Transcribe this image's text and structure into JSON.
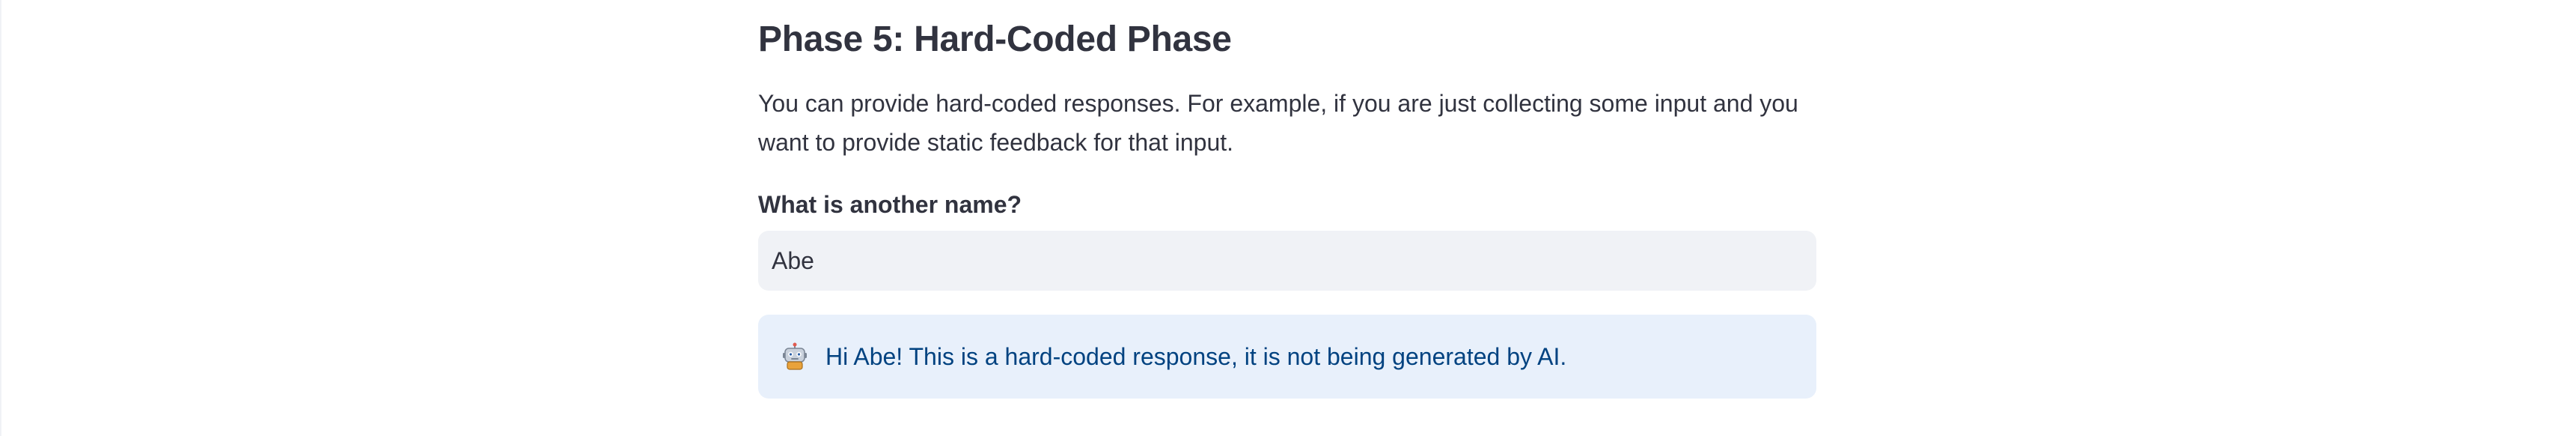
{
  "section": {
    "title": "Phase 5: Hard-Coded Phase",
    "description": "You can provide hard-coded responses. For example, if you are just collecting some input and you want to provide static feedback for that input."
  },
  "form": {
    "label": "What is another name?",
    "value": "Abe"
  },
  "alert": {
    "icon": "robot-icon",
    "message": "Hi Abe! This is a hard-coded response, it is not being generated by AI."
  },
  "colors": {
    "text": "#31333f",
    "input_background": "#f0f2f6",
    "alert_background": "#e8f0fb",
    "alert_text": "#004280"
  }
}
